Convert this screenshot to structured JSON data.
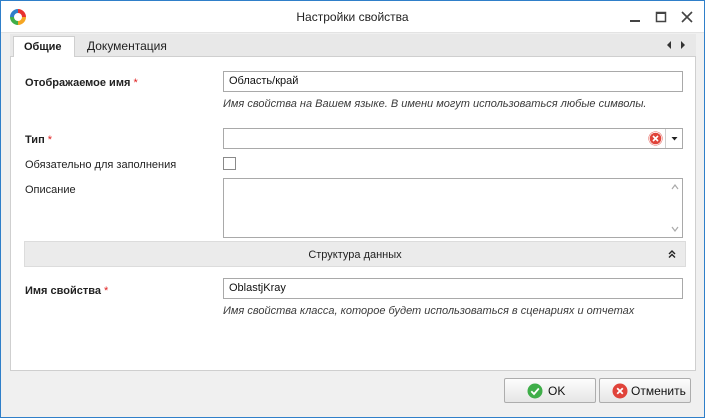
{
  "window": {
    "title": "Настройки свойства"
  },
  "tabs": [
    {
      "label": "Общие",
      "active": true
    },
    {
      "label": "Документация",
      "active": false
    }
  ],
  "form": {
    "display_name": {
      "label": "Отображаемое имя",
      "required_mark": "*",
      "value": "Область/край",
      "hint": "Имя свойства на Вашем языке. В имени могут использоваться любые символы."
    },
    "type": {
      "label": "Тип",
      "required_mark": "*",
      "value": ""
    },
    "required_field": {
      "label": "Обязательно для заполнения",
      "checked": false
    },
    "description": {
      "label": "Описание",
      "value": ""
    },
    "data_structure_section": {
      "title": "Структура данных",
      "expanded": true
    },
    "property_name": {
      "label": "Имя свойства",
      "required_mark": "*",
      "value": "OblastjKray",
      "hint": "Имя свойства класса, которое будет использоваться в сценариях и отчетах"
    }
  },
  "buttons": {
    "ok": "OK",
    "cancel": "Отменить"
  },
  "colors": {
    "window_border": "#2f7fc9",
    "required": "#e02020",
    "ok_icon": "#3fae49",
    "cancel_icon": "#e0433a"
  }
}
